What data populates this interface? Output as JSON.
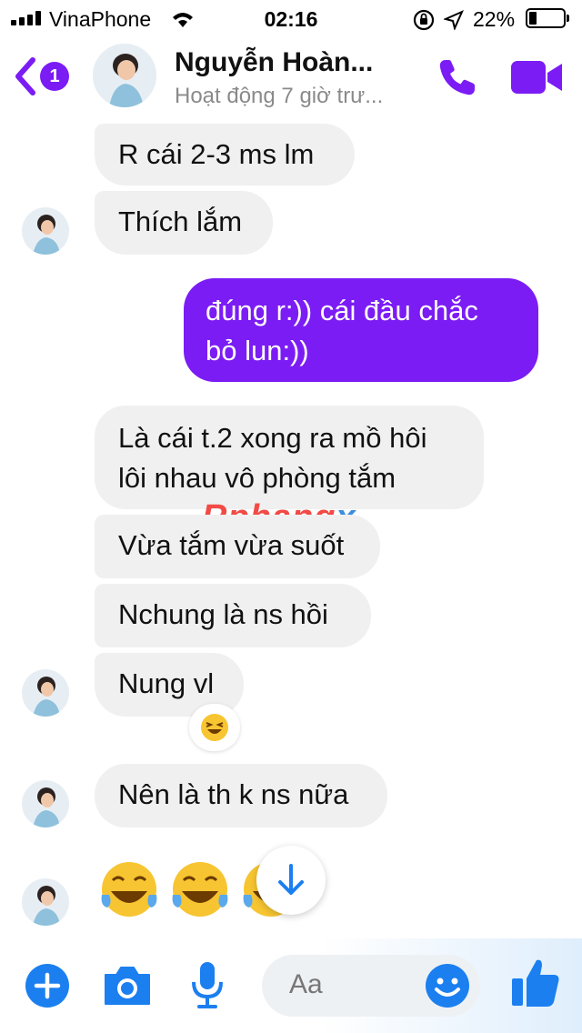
{
  "status_bar": {
    "carrier": "VinaPhone",
    "time": "02:16",
    "battery": "22%"
  },
  "header": {
    "back_badge": "1",
    "contact_name": "Nguyễn Hoàn...",
    "contact_status": "Hoạt động 7 giờ trư..."
  },
  "messages": [
    {
      "from": "contact",
      "text": "R cái 2-3 ms lm"
    },
    {
      "from": "contact",
      "text": "Thích lắm"
    },
    {
      "from": "me",
      "lines": [
        "đúng r:)) cái đầu chắc",
        "bỏ lun:))"
      ]
    },
    {
      "from": "contact",
      "lines": [
        "Là cái t.2 xong ra mồ hôi",
        "lôi nhau vô phòng tắm"
      ]
    },
    {
      "from": "contact",
      "text": "Vừa tắm vừa suốt"
    },
    {
      "from": "contact",
      "text": "Nchung là ns hồi"
    },
    {
      "from": "contact",
      "text": "Nung vl"
    },
    {
      "from": "contact",
      "text": "Nên là th k ns nữa"
    }
  ],
  "watermark": {
    "part1": "Rphang",
    "part2": "x"
  },
  "composer": {
    "placeholder": "Aa"
  },
  "colors": {
    "accent": "#7b1cf5",
    "composer_blue": "#1b7ff0"
  }
}
